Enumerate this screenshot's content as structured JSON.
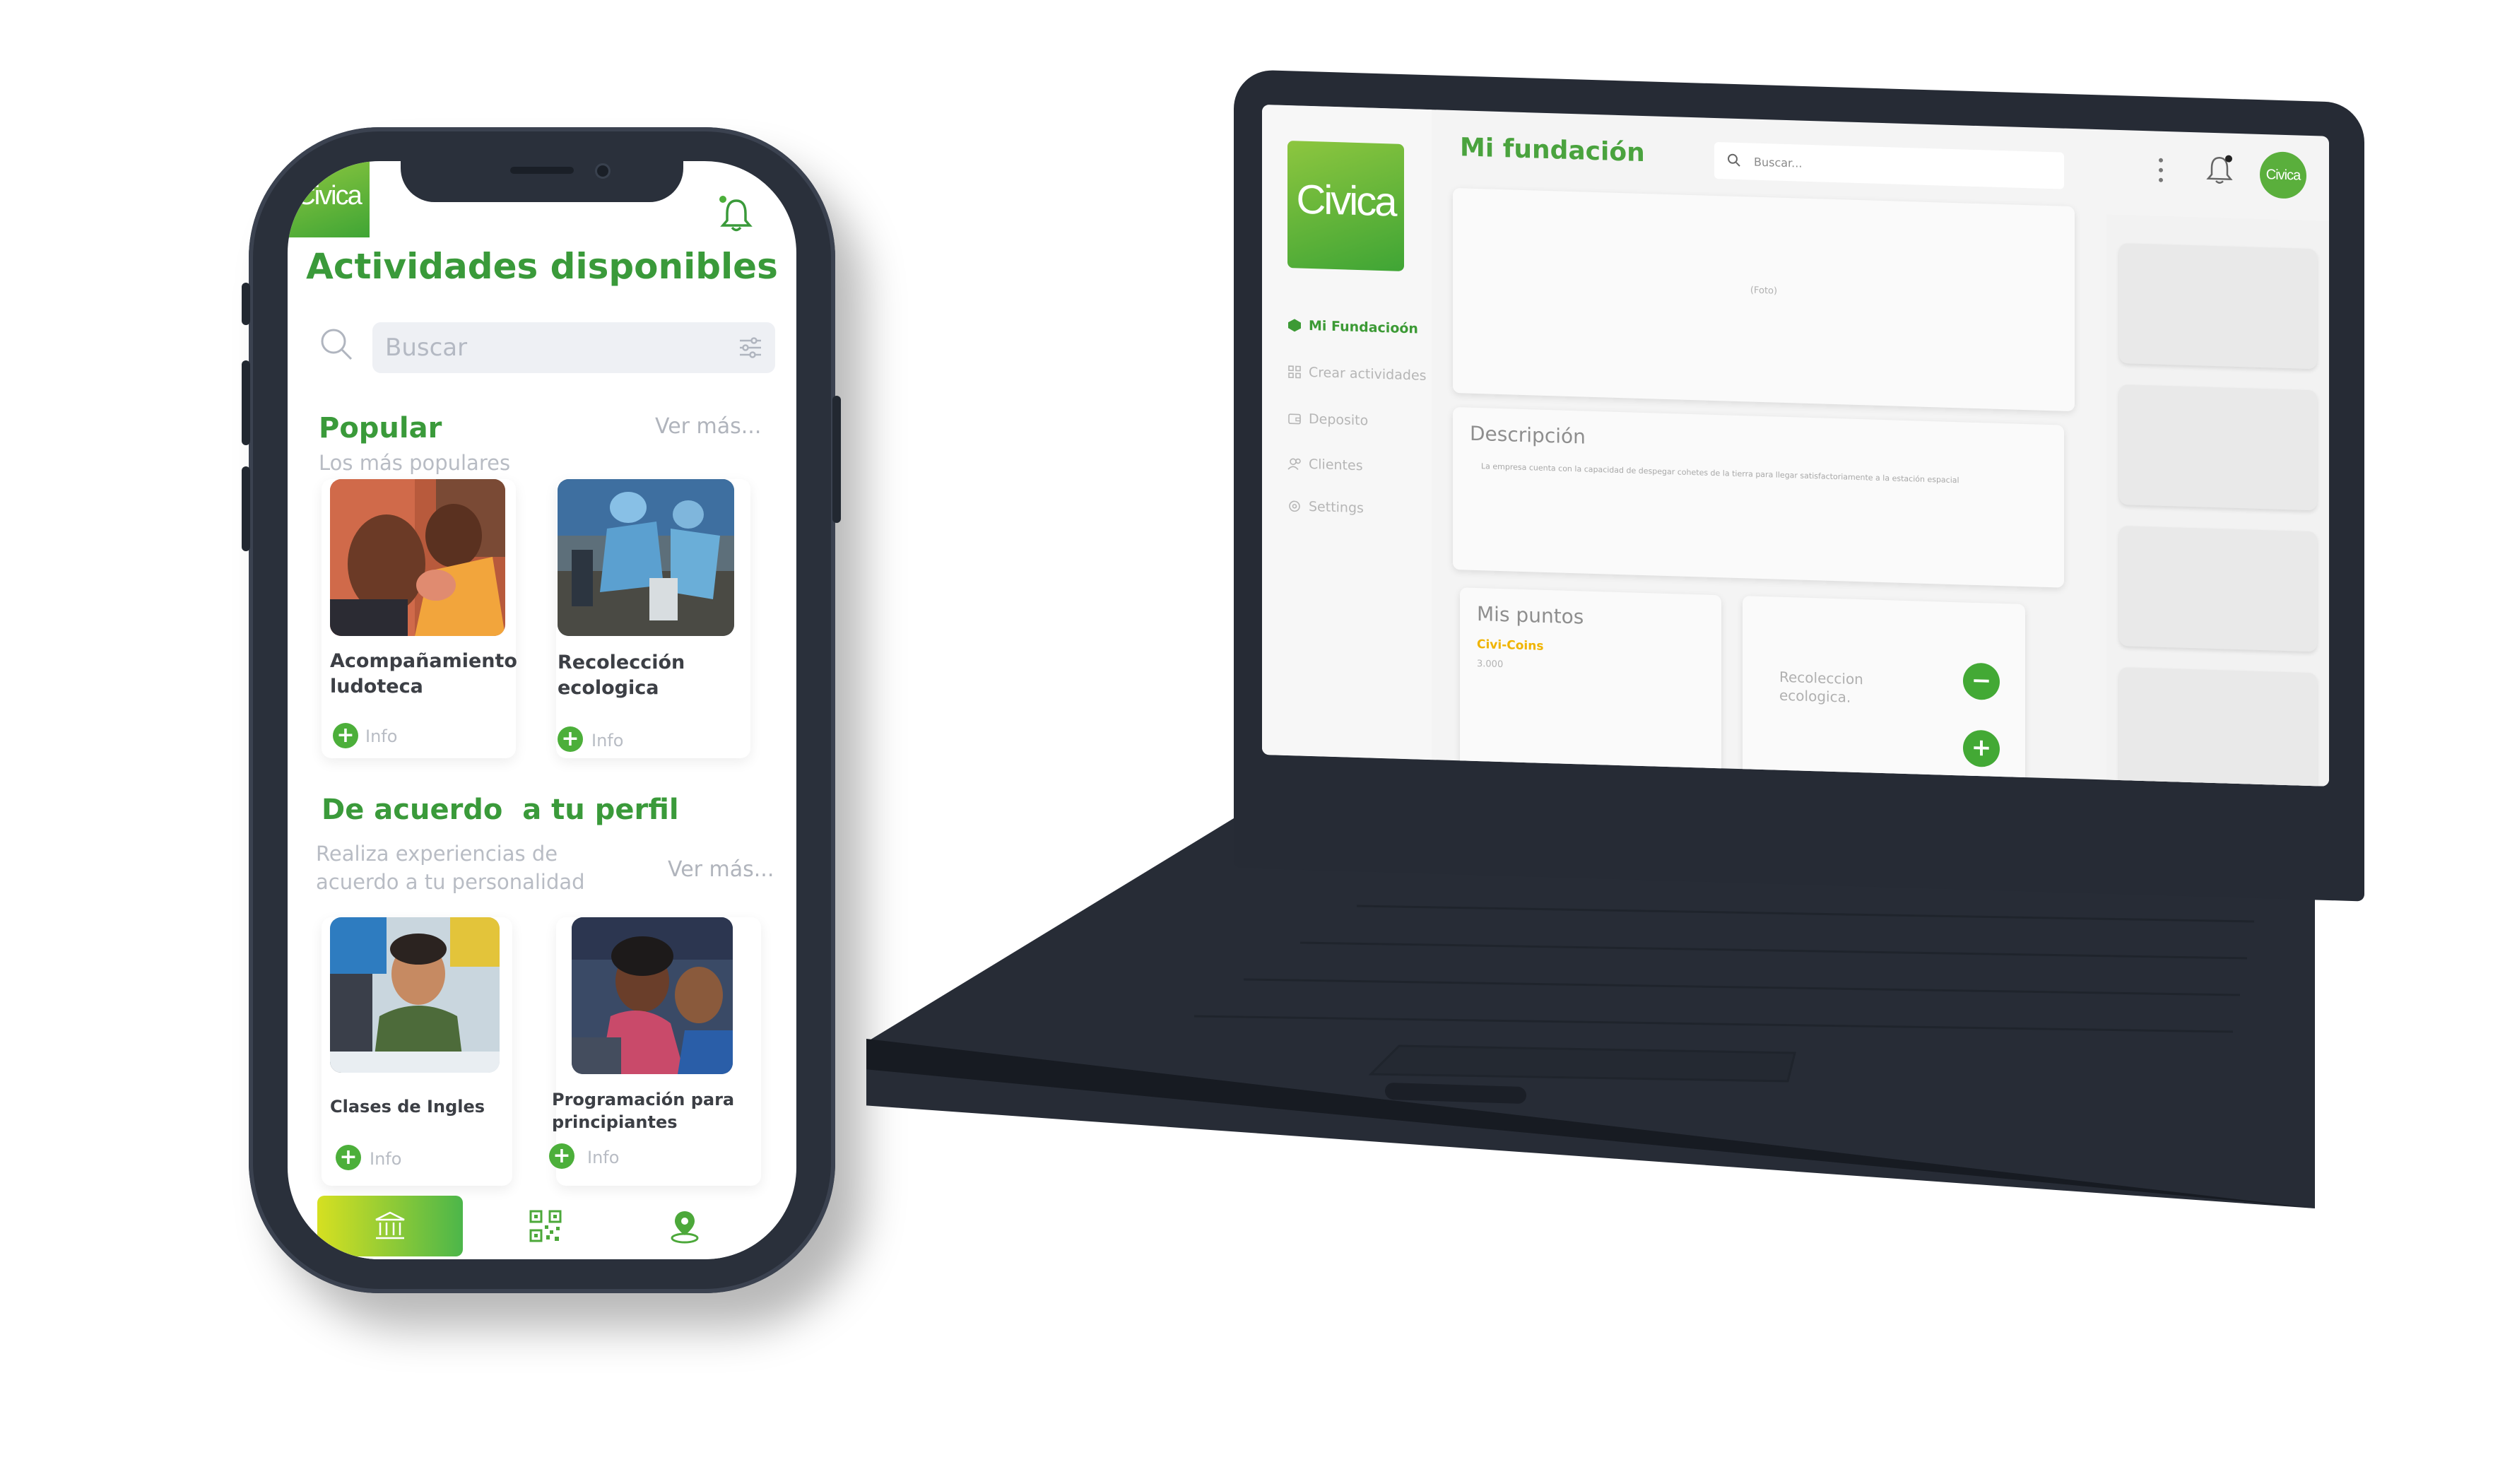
{
  "colors": {
    "brand_green": "#3fa535",
    "accent_yellow": "#f0b400",
    "device_frame": "#2a303b"
  },
  "mobile": {
    "logo": "Civica",
    "title": "Actividades disponibles",
    "search_placeholder": "Buscar",
    "popular": {
      "heading": "Popular",
      "subtitle": "Los más populares",
      "see_more": "Ver más...",
      "cards": [
        {
          "title_line1": "Acompañamiento",
          "title_line2": "ludoteca",
          "info": "Info"
        },
        {
          "title_line1": "Recolección",
          "title_line2": "ecologica",
          "info": "Info"
        }
      ]
    },
    "profile": {
      "heading": "De acuerdo  a tu perfil",
      "subtitle_line1": "Realiza experiencias de",
      "subtitle_line2": "acuerdo a tu personalidad",
      "see_more": "Ver más...",
      "cards": [
        {
          "title_line1": "Clases de Ingles",
          "title_line2": "",
          "info": "Info"
        },
        {
          "title_line1": "Programación para",
          "title_line2": "principiantes",
          "info": "Info"
        }
      ]
    },
    "nav": {
      "home_icon": "bank-icon",
      "qr_icon": "qr-code-icon",
      "map_icon": "map-pin-icon"
    }
  },
  "desktop": {
    "logo": "Civica",
    "avatar": "Civica",
    "page_title": "Mi fundación",
    "search_placeholder": "Buscar...",
    "sidebar": [
      {
        "label": "Mi Fundacioón",
        "icon": "cube-icon"
      },
      {
        "label": "Crear actividades",
        "icon": "grid-icon"
      },
      {
        "label": "Deposito",
        "icon": "wallet-icon"
      },
      {
        "label": "Clientes",
        "icon": "users-icon"
      },
      {
        "label": "Settings",
        "icon": "gear-icon"
      }
    ],
    "photo_placeholder": "(Foto)",
    "description": {
      "heading": "Descripción",
      "text": "La empresa cuenta con la capacidad de despegar cohetes de la tierra para llegar satisfactoriamente a la estación espacial"
    },
    "points": {
      "heading": "Mis puntos",
      "currency": "Civi-Coins",
      "value": "3.000"
    },
    "activity": {
      "name_line1": "Recoleccion",
      "name_line2": "ecologica.",
      "minus": "−",
      "plus": "+"
    }
  }
}
